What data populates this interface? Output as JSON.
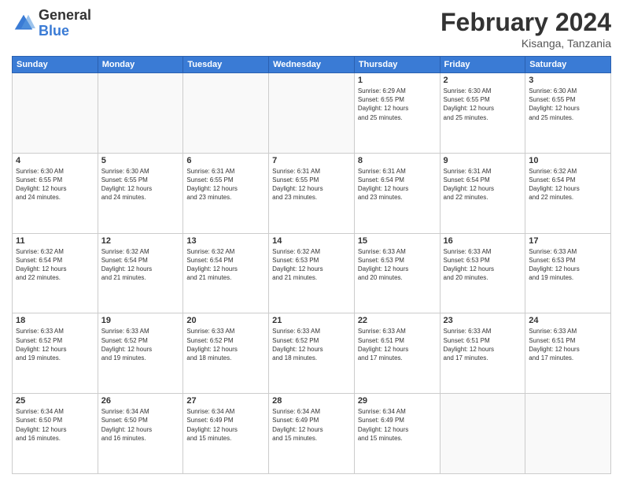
{
  "header": {
    "logo_general": "General",
    "logo_blue": "Blue",
    "month_title": "February 2024",
    "location": "Kisanga, Tanzania"
  },
  "weekdays": [
    "Sunday",
    "Monday",
    "Tuesday",
    "Wednesday",
    "Thursday",
    "Friday",
    "Saturday"
  ],
  "weeks": [
    [
      {
        "day": "",
        "info": ""
      },
      {
        "day": "",
        "info": ""
      },
      {
        "day": "",
        "info": ""
      },
      {
        "day": "",
        "info": ""
      },
      {
        "day": "1",
        "info": "Sunrise: 6:29 AM\nSunset: 6:55 PM\nDaylight: 12 hours\nand 25 minutes."
      },
      {
        "day": "2",
        "info": "Sunrise: 6:30 AM\nSunset: 6:55 PM\nDaylight: 12 hours\nand 25 minutes."
      },
      {
        "day": "3",
        "info": "Sunrise: 6:30 AM\nSunset: 6:55 PM\nDaylight: 12 hours\nand 25 minutes."
      }
    ],
    [
      {
        "day": "4",
        "info": "Sunrise: 6:30 AM\nSunset: 6:55 PM\nDaylight: 12 hours\nand 24 minutes."
      },
      {
        "day": "5",
        "info": "Sunrise: 6:30 AM\nSunset: 6:55 PM\nDaylight: 12 hours\nand 24 minutes."
      },
      {
        "day": "6",
        "info": "Sunrise: 6:31 AM\nSunset: 6:55 PM\nDaylight: 12 hours\nand 23 minutes."
      },
      {
        "day": "7",
        "info": "Sunrise: 6:31 AM\nSunset: 6:55 PM\nDaylight: 12 hours\nand 23 minutes."
      },
      {
        "day": "8",
        "info": "Sunrise: 6:31 AM\nSunset: 6:54 PM\nDaylight: 12 hours\nand 23 minutes."
      },
      {
        "day": "9",
        "info": "Sunrise: 6:31 AM\nSunset: 6:54 PM\nDaylight: 12 hours\nand 22 minutes."
      },
      {
        "day": "10",
        "info": "Sunrise: 6:32 AM\nSunset: 6:54 PM\nDaylight: 12 hours\nand 22 minutes."
      }
    ],
    [
      {
        "day": "11",
        "info": "Sunrise: 6:32 AM\nSunset: 6:54 PM\nDaylight: 12 hours\nand 22 minutes."
      },
      {
        "day": "12",
        "info": "Sunrise: 6:32 AM\nSunset: 6:54 PM\nDaylight: 12 hours\nand 21 minutes."
      },
      {
        "day": "13",
        "info": "Sunrise: 6:32 AM\nSunset: 6:54 PM\nDaylight: 12 hours\nand 21 minutes."
      },
      {
        "day": "14",
        "info": "Sunrise: 6:32 AM\nSunset: 6:53 PM\nDaylight: 12 hours\nand 21 minutes."
      },
      {
        "day": "15",
        "info": "Sunrise: 6:33 AM\nSunset: 6:53 PM\nDaylight: 12 hours\nand 20 minutes."
      },
      {
        "day": "16",
        "info": "Sunrise: 6:33 AM\nSunset: 6:53 PM\nDaylight: 12 hours\nand 20 minutes."
      },
      {
        "day": "17",
        "info": "Sunrise: 6:33 AM\nSunset: 6:53 PM\nDaylight: 12 hours\nand 19 minutes."
      }
    ],
    [
      {
        "day": "18",
        "info": "Sunrise: 6:33 AM\nSunset: 6:52 PM\nDaylight: 12 hours\nand 19 minutes."
      },
      {
        "day": "19",
        "info": "Sunrise: 6:33 AM\nSunset: 6:52 PM\nDaylight: 12 hours\nand 19 minutes."
      },
      {
        "day": "20",
        "info": "Sunrise: 6:33 AM\nSunset: 6:52 PM\nDaylight: 12 hours\nand 18 minutes."
      },
      {
        "day": "21",
        "info": "Sunrise: 6:33 AM\nSunset: 6:52 PM\nDaylight: 12 hours\nand 18 minutes."
      },
      {
        "day": "22",
        "info": "Sunrise: 6:33 AM\nSunset: 6:51 PM\nDaylight: 12 hours\nand 17 minutes."
      },
      {
        "day": "23",
        "info": "Sunrise: 6:33 AM\nSunset: 6:51 PM\nDaylight: 12 hours\nand 17 minutes."
      },
      {
        "day": "24",
        "info": "Sunrise: 6:33 AM\nSunset: 6:51 PM\nDaylight: 12 hours\nand 17 minutes."
      }
    ],
    [
      {
        "day": "25",
        "info": "Sunrise: 6:34 AM\nSunset: 6:50 PM\nDaylight: 12 hours\nand 16 minutes."
      },
      {
        "day": "26",
        "info": "Sunrise: 6:34 AM\nSunset: 6:50 PM\nDaylight: 12 hours\nand 16 minutes."
      },
      {
        "day": "27",
        "info": "Sunrise: 6:34 AM\nSunset: 6:49 PM\nDaylight: 12 hours\nand 15 minutes."
      },
      {
        "day": "28",
        "info": "Sunrise: 6:34 AM\nSunset: 6:49 PM\nDaylight: 12 hours\nand 15 minutes."
      },
      {
        "day": "29",
        "info": "Sunrise: 6:34 AM\nSunset: 6:49 PM\nDaylight: 12 hours\nand 15 minutes."
      },
      {
        "day": "",
        "info": ""
      },
      {
        "day": "",
        "info": ""
      }
    ]
  ]
}
